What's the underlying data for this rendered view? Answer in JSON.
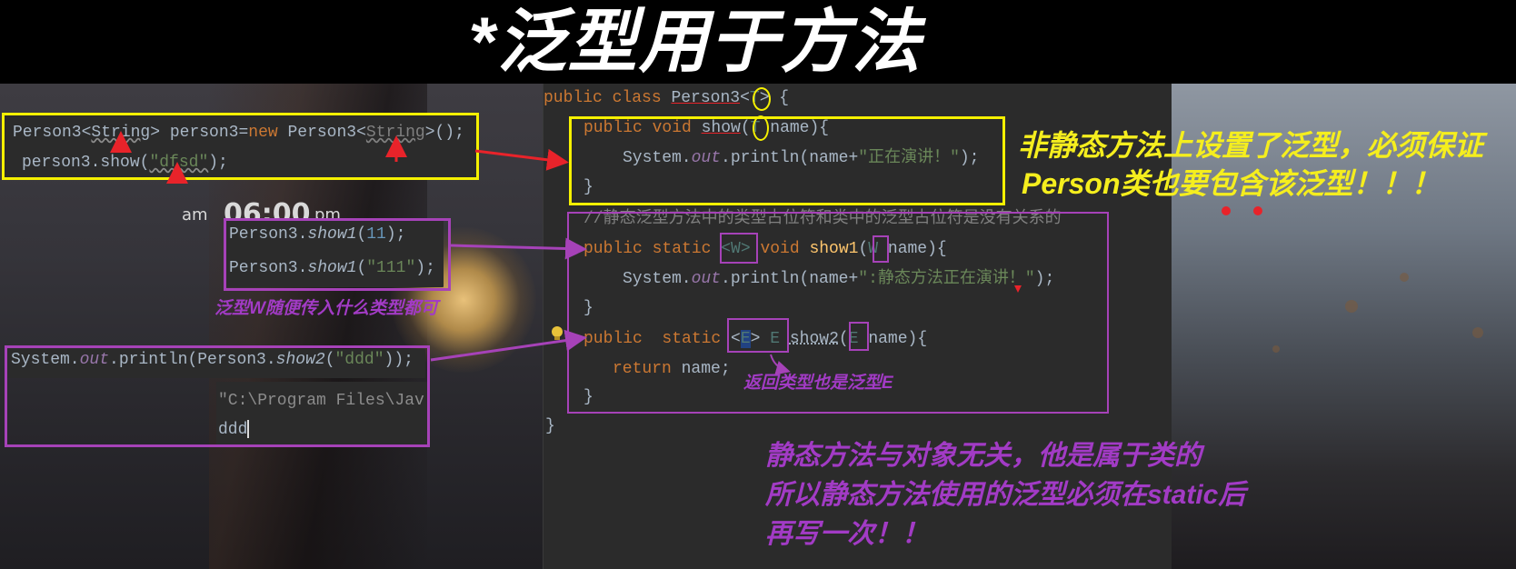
{
  "title": "*泛型用于方法",
  "clock": {
    "am": "am",
    "time": "06:00",
    "pm": "pm"
  },
  "snippet1": {
    "line1": {
      "a": "Person3<",
      "b": "String",
      "c": "> person3=",
      "d": "new",
      "e": " Person3<",
      "f": "String",
      "g": ">();"
    },
    "line2": {
      "a": "person3.show(",
      "b": "\"dfsd\"",
      "c": ");"
    }
  },
  "snippet2": {
    "line1": {
      "a": "Person3.",
      "b": "show1",
      "c": "(",
      "d": "11",
      "e": ");"
    },
    "line2": {
      "a": "Person3.",
      "b": "show1",
      "c": "(",
      "d": "\"111\"",
      "e": ");"
    }
  },
  "snippet3": {
    "line1": {
      "a": "System.",
      "b": "out",
      "c": ".println(Person3.",
      "d": "show2",
      "e": "(",
      "f": "\"ddd\"",
      "g": "));"
    },
    "console1": "\"C:\\Program Files\\Jav",
    "console2": "ddd"
  },
  "editor": {
    "l1": {
      "a": "public class ",
      "b": "Person3",
      "c": "<",
      "d": "T",
      "e": ">",
      "f": " {"
    },
    "l2": {
      "a": "public void ",
      "b": "show",
      "c": "(",
      "d": "T",
      "e": " name){"
    },
    "l3": {
      "a": "System.",
      "b": "out",
      "c": ".println(name+",
      "d": "\"正在演讲！\"",
      "e": ");"
    },
    "l4": "}",
    "l5": "//静态泛型方法中的类型占位符和类中的泛型占位符是没有关系的",
    "l6": {
      "a": "public static ",
      "b": "<W>",
      "c": " void ",
      "d": "show1",
      "e": "(",
      "f": "W",
      "g": " name){"
    },
    "l7": {
      "a": "System.",
      "b": "out",
      "c": ".println(name+",
      "d": "\":静态方法正在演讲！\"",
      "e": ");"
    },
    "l8": "}",
    "l9": {
      "a": "public  static ",
      "b": "<",
      "c": "E",
      "d": ">",
      "e": " E ",
      "f": "show2",
      "g": "(",
      "h": "E",
      "i": " name){"
    },
    "l10": {
      "a": "return",
      "b": " name;"
    },
    "l11": "}",
    "l12": "}"
  },
  "notes": {
    "yellow1": "非静态方法上设置了泛型，必须保证",
    "yellow2": "Person类也要包含该泛型！！！",
    "w_note": "泛型W随便传入什么类型都可",
    "e_note": "返回类型也是泛型E",
    "static1": "静态方法与对象无关，他是属于类的",
    "static2": "所以静态方法使用的泛型必须在static后",
    "static3": "再写一次！！"
  },
  "colors": {
    "yellow": "#f5f000",
    "purple": "#a642b8",
    "red": "#e8232a"
  },
  "icons": {
    "bulb": "lightbulb-icon"
  }
}
